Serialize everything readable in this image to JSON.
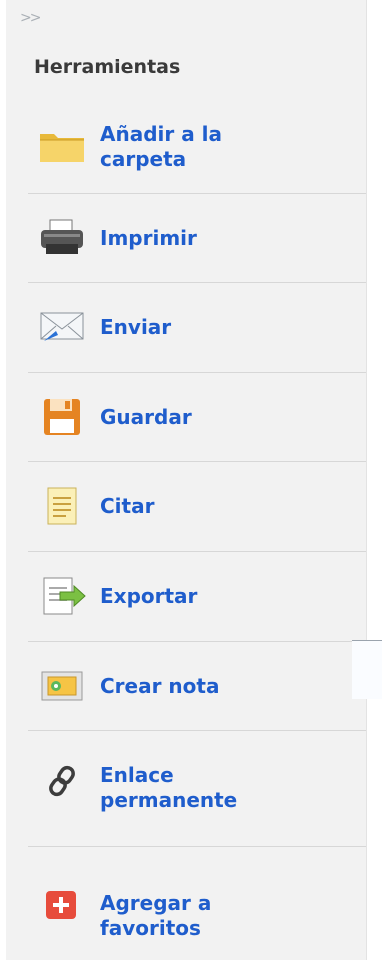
{
  "sidebar": {
    "collapse_icon": ">>",
    "title": "Herramientas",
    "items": [
      {
        "label": "Añadir a la carpeta",
        "icon": "folder-icon"
      },
      {
        "label": "Imprimir",
        "icon": "printer-icon"
      },
      {
        "label": "Enviar",
        "icon": "email-icon"
      },
      {
        "label": "Guardar",
        "icon": "save-icon"
      },
      {
        "label": "Citar",
        "icon": "cite-icon"
      },
      {
        "label": "Exportar",
        "icon": "export-icon"
      },
      {
        "label": "Crear nota",
        "icon": "note-icon"
      },
      {
        "label": "Enlace permanente",
        "icon": "link-icon"
      },
      {
        "label": "Agregar a favoritos",
        "icon": "add-favorite-icon"
      }
    ]
  },
  "colors": {
    "link": "#1f5dcc",
    "heading": "#3a3a3a",
    "panel_bg": "#f2f2f2",
    "divider": "#d7d7d7"
  }
}
